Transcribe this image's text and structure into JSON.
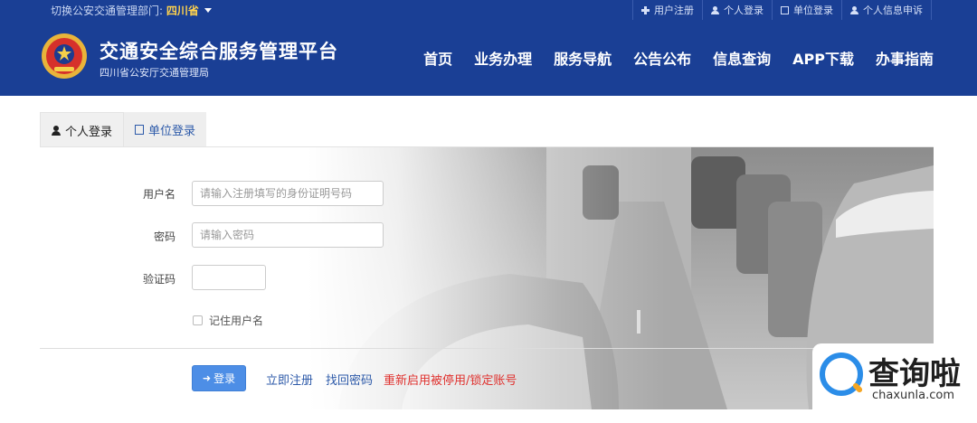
{
  "topbar": {
    "region_prefix": "切换公安交通管理部门: ",
    "region_name": "四川省",
    "links": [
      {
        "label": "用户注册",
        "icon": "plus-icon"
      },
      {
        "label": "个人登录",
        "icon": "user-icon"
      },
      {
        "label": "单位登录",
        "icon": "document-icon"
      },
      {
        "label": "个人信息申诉",
        "icon": "user-icon"
      }
    ]
  },
  "header": {
    "title": "交通安全综合服务管理平台",
    "subtitle": "四川省公安厅交通管理局",
    "nav": [
      "首页",
      "业务办理",
      "服务导航",
      "公告公布",
      "信息查询",
      "APP下载",
      "办事指南"
    ]
  },
  "tabs": {
    "personal": "个人登录",
    "unit": "单位登录"
  },
  "form": {
    "username_label": "用户名",
    "username_placeholder": "请输入注册填写的身份证明号码",
    "password_label": "密码",
    "password_placeholder": "请输入密码",
    "captcha_label": "验证码",
    "remember_label": "记住用户名",
    "remember_checked": false
  },
  "actions": {
    "login": "登录",
    "register": "立即注册",
    "recover": "找回密码",
    "reactivate": "重新启用被停用/锁定账号"
  },
  "watermark": {
    "title": "查询啦",
    "url": "chaxunla.com"
  },
  "colors": {
    "header_bg": "#1a3f95",
    "region_highlight": "#ffd24d",
    "login_button": "#4d8ee6",
    "link_blue": "#2d5aa9",
    "link_red": "#e0322f"
  }
}
